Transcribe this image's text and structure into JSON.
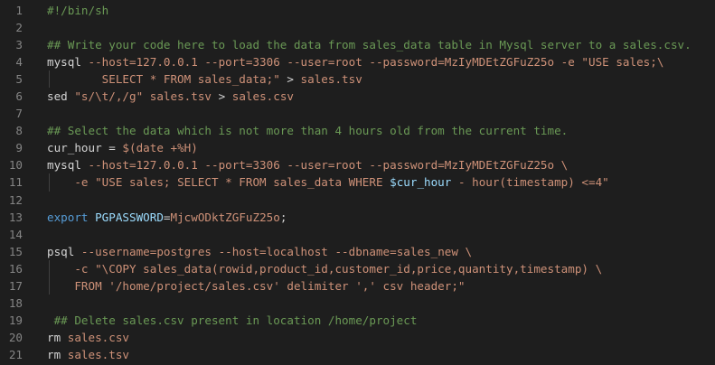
{
  "editor": {
    "lines": [
      {
        "num": "1",
        "tokens": [
          {
            "t": "#!/bin/sh",
            "c": "cm"
          }
        ]
      },
      {
        "num": "2",
        "tokens": []
      },
      {
        "num": "3",
        "tokens": [
          {
            "t": "## Write your code here to load the data from sales_data table in Mysql server to a sales.csv.",
            "c": "cm"
          }
        ]
      },
      {
        "num": "4",
        "tokens": [
          {
            "t": "mysql",
            "c": "kw"
          },
          {
            "t": " --host=127.0.0.1 --port=3306 --user=root --password=MzIyMDEtZGFuZ25o -e ",
            "c": "st"
          },
          {
            "t": "\"USE sales;\\",
            "c": "st"
          }
        ]
      },
      {
        "num": "5",
        "guide": true,
        "tokens": [
          {
            "t": "        SELECT * FROM sales_data;\"",
            "c": "st"
          },
          {
            "t": " > ",
            "c": "op"
          },
          {
            "t": "sales.tsv",
            "c": "st"
          }
        ]
      },
      {
        "num": "6",
        "tokens": [
          {
            "t": "sed ",
            "c": "kw"
          },
          {
            "t": "\"s/\\t/,/g\"",
            "c": "st"
          },
          {
            "t": " sales.tsv ",
            "c": "st"
          },
          {
            "t": "> ",
            "c": "op"
          },
          {
            "t": "sales.csv",
            "c": "st"
          }
        ]
      },
      {
        "num": "7",
        "tokens": []
      },
      {
        "num": "8",
        "tokens": [
          {
            "t": "## Select the data which is not more than 4 hours old from the current time.",
            "c": "cm"
          }
        ]
      },
      {
        "num": "9",
        "tokens": [
          {
            "t": "cur_hour",
            "c": "kw"
          },
          {
            "t": " = ",
            "c": "op"
          },
          {
            "t": "$(date +%H)",
            "c": "st"
          }
        ]
      },
      {
        "num": "10",
        "tokens": [
          {
            "t": "mysql",
            "c": "kw"
          },
          {
            "t": " --host=127.0.0.1 --port=3306 --user=root --password=MzIyMDEtZGFuZ25o \\",
            "c": "st"
          }
        ]
      },
      {
        "num": "11",
        "guide": true,
        "tokens": [
          {
            "t": "    -e ",
            "c": "st"
          },
          {
            "t": "\"USE sales; SELECT * FROM sales_data WHERE ",
            "c": "st"
          },
          {
            "t": "$cur_hour",
            "c": "va"
          },
          {
            "t": " - hour(timestamp) <=4\"",
            "c": "st"
          }
        ]
      },
      {
        "num": "12",
        "tokens": []
      },
      {
        "num": "13",
        "tokens": [
          {
            "t": "export ",
            "c": "ex"
          },
          {
            "t": "PGPASSWORD",
            "c": "va"
          },
          {
            "t": "=",
            "c": "op"
          },
          {
            "t": "MjcwODktZGFuZ25o",
            "c": "st"
          },
          {
            "t": ";",
            "c": "op"
          }
        ]
      },
      {
        "num": "14",
        "tokens": []
      },
      {
        "num": "15",
        "tokens": [
          {
            "t": "psql",
            "c": "kw"
          },
          {
            "t": " --username=postgres --host=localhost --dbname=sales_new \\",
            "c": "st"
          }
        ]
      },
      {
        "num": "16",
        "guide": true,
        "tokens": [
          {
            "t": "    -c ",
            "c": "st"
          },
          {
            "t": "\"\\COPY sales_data(rowid,product_id,customer_id,price,quantity,timestamp) \\",
            "c": "st"
          }
        ]
      },
      {
        "num": "17",
        "guide": true,
        "tokens": [
          {
            "t": "    FROM '/home/project/sales.csv' delimiter ',' csv header;\"",
            "c": "st"
          }
        ]
      },
      {
        "num": "18",
        "tokens": []
      },
      {
        "num": "19",
        "tokens": [
          {
            "t": " ## Delete sales.csv present in location /home/project",
            "c": "cm"
          }
        ]
      },
      {
        "num": "20",
        "tokens": [
          {
            "t": "rm",
            "c": "kw"
          },
          {
            "t": " sales.csv",
            "c": "st"
          }
        ]
      },
      {
        "num": "21",
        "tokens": [
          {
            "t": "rm",
            "c": "kw"
          },
          {
            "t": " sales.tsv",
            "c": "st"
          }
        ]
      }
    ]
  }
}
